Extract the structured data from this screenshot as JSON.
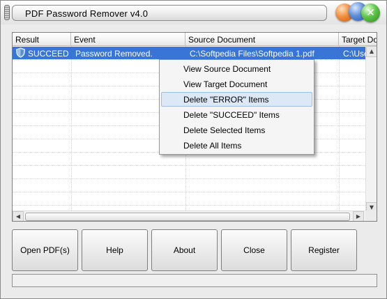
{
  "window": {
    "title": "PDF Password Remover v4.0"
  },
  "list": {
    "columns": [
      "Result",
      "Event",
      "Source Document",
      "Target Document"
    ],
    "rows": [
      {
        "result": "SUCCEED",
        "event": "Password Removed.",
        "source": "C:\\Softpedia Files\\Softpedia 1.pdf",
        "target": "C:\\Users\\"
      }
    ]
  },
  "context_menu": {
    "items": [
      {
        "label": "View Source Document"
      },
      {
        "label": "View Target Document"
      },
      {
        "label": "Delete \"ERROR\" Items",
        "highlighted": true
      },
      {
        "label": "Delete \"SUCCEED\" Items"
      },
      {
        "label": "Delete Selected Items"
      },
      {
        "label": "Delete All Items"
      }
    ]
  },
  "buttons": {
    "open": "Open PDF(s)",
    "help": "Help",
    "about": "About",
    "close": "Close",
    "register": "Register"
  },
  "icons": {
    "grip": "grip-handle-icon",
    "minimize": "orange-orb-icon",
    "maximize": "blue-orb-icon",
    "close": "green-close-orb-icon",
    "success": "shield-icon"
  },
  "colors": {
    "selection": "#3875d7",
    "menu_highlight": "#dce8f6",
    "window_bg": "#ebebeb"
  }
}
